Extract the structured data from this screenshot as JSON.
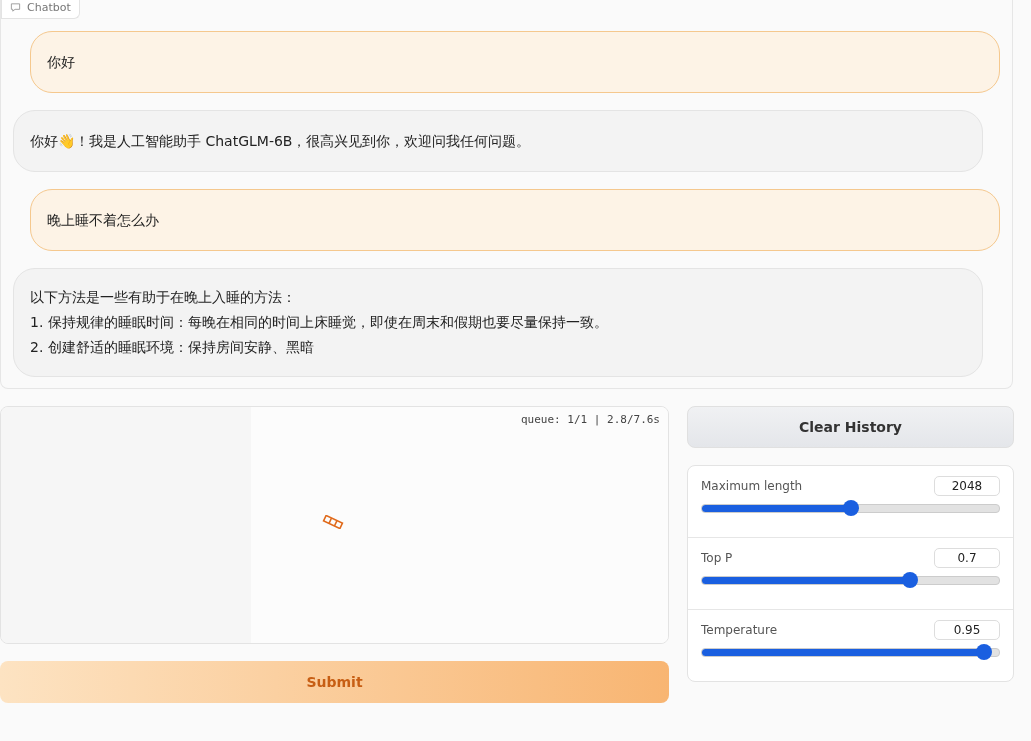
{
  "chatbot": {
    "label": "Chatbot",
    "messages": [
      {
        "kind": "user",
        "lines": [
          "你好"
        ]
      },
      {
        "kind": "bot",
        "lines": [
          "你好👋！我是人工智能助手 ChatGLM-6B，很高兴见到你，欢迎问我任何问题。"
        ]
      },
      {
        "kind": "user",
        "lines": [
          "晚上睡不着怎么办"
        ]
      },
      {
        "kind": "bot",
        "lines": [
          "以下方法是一些有助于在晚上入睡的方法：",
          "1. 保持规律的睡眠时间：每晚在相同的时间上床睡觉，即使在周末和假期也要尽量保持一致。",
          "2. 创建舒适的睡眠环境：保持房间安静、黑暗"
        ]
      }
    ]
  },
  "input": {
    "status": "queue: 1/1 | 2.8/7.6s"
  },
  "submit": "Submit",
  "clear": "Clear History",
  "sliders": [
    {
      "label": "Maximum length",
      "value": "2048",
      "level": 0.5
    },
    {
      "label": "Top P",
      "value": "0.7",
      "level": 0.7
    },
    {
      "label": "Temperature",
      "value": "0.95",
      "level": 0.95
    }
  ]
}
